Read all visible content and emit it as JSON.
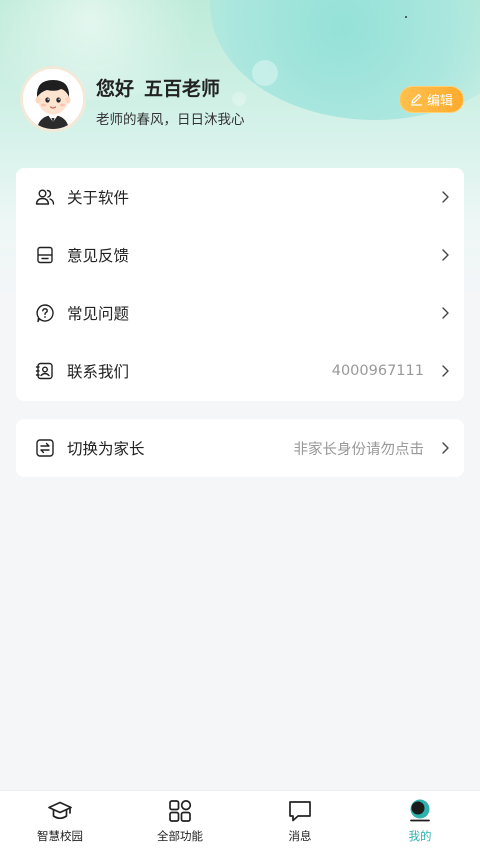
{
  "profile": {
    "greeting_prefix": "您好",
    "name": "五百老师",
    "motto": "老师的春风，日日沐我心",
    "edit_label": "编辑"
  },
  "menu": [
    {
      "label": "关于软件",
      "icon": "users-icon"
    },
    {
      "label": "意见反馈",
      "icon": "feedback-icon"
    },
    {
      "label": "常见问题",
      "icon": "question-icon"
    },
    {
      "label": "联系我们",
      "icon": "contact-icon",
      "value": "4000967111"
    }
  ],
  "switch": {
    "label": "切换为家长",
    "hint": "非家长身份请勿点击",
    "icon": "switch-icon"
  },
  "tabs": [
    {
      "label": "智慧校园",
      "icon": "graduation-cap-icon"
    },
    {
      "label": "全部功能",
      "icon": "apps-grid-icon"
    },
    {
      "label": "消息",
      "icon": "message-icon"
    },
    {
      "label": "我的",
      "icon": "profile-icon",
      "active": true
    }
  ],
  "colors": {
    "accent": "#2fb2ad",
    "edit_button": "#ffb63b"
  }
}
